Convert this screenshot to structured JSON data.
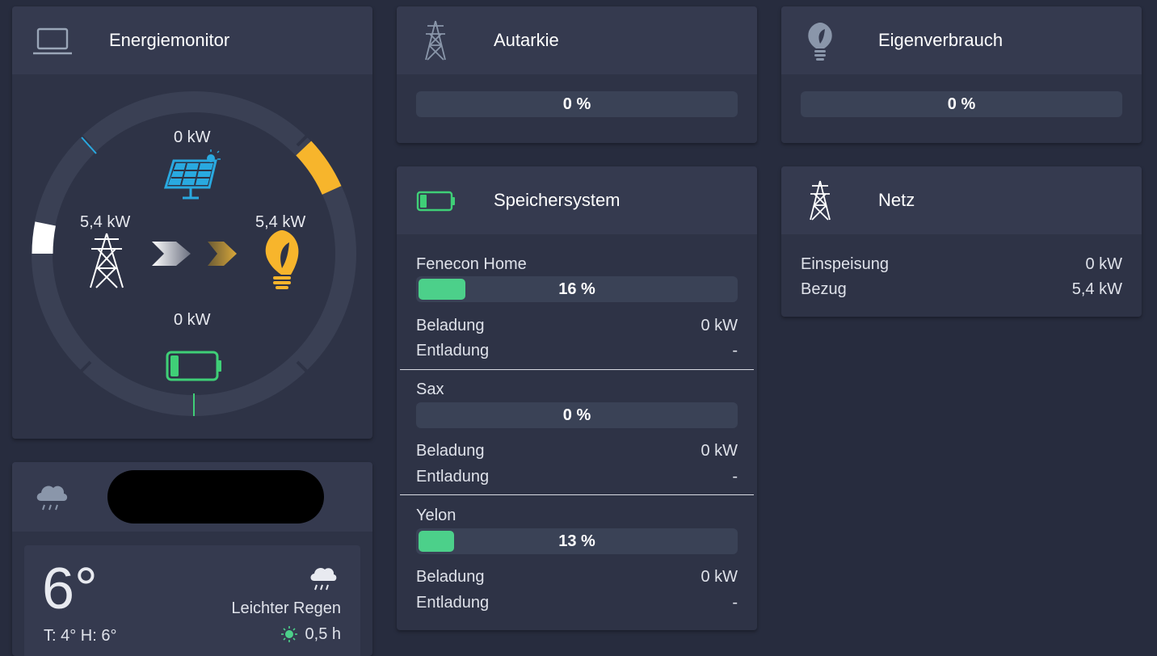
{
  "energy": {
    "title": "Energiemonitor",
    "solar_kw": "0 kW",
    "grid_kw": "5,4 kW",
    "consumption_kw": "5,4 kW",
    "storage_kw": "0 kW",
    "colors": {
      "solar": "#29a9e0",
      "consumption": "#f7b52c",
      "storage": "#3fcf77",
      "grid": "#ffffff"
    }
  },
  "autarkie": {
    "title": "Autarkie",
    "percent_text": "0 %",
    "percent": 0
  },
  "eigenverbrauch": {
    "title": "Eigenverbrauch",
    "percent_text": "0 %",
    "percent": 0
  },
  "speicher": {
    "title": "Speichersystem",
    "charge_label": "Beladung",
    "discharge_label": "Entladung",
    "systems": [
      {
        "name": "Fenecon Home",
        "percent_text": "16 %",
        "percent": 16,
        "charge": "0 kW",
        "discharge": "-"
      },
      {
        "name": "Sax",
        "percent_text": "0 %",
        "percent": 0,
        "charge": "0 kW",
        "discharge": "-"
      },
      {
        "name": "Yelon",
        "percent_text": "13 %",
        "percent": 13,
        "charge": "0 kW",
        "discharge": "-"
      }
    ]
  },
  "netz": {
    "title": "Netz",
    "feed_label": "Einspeisung",
    "feed_value": "0 kW",
    "draw_label": "Bezug",
    "draw_value": "5,4 kW"
  },
  "weather": {
    "temp": "6°",
    "range": "T: 4° H: 6°",
    "condition": "Leichter Regen",
    "sun": "0,5 h"
  }
}
